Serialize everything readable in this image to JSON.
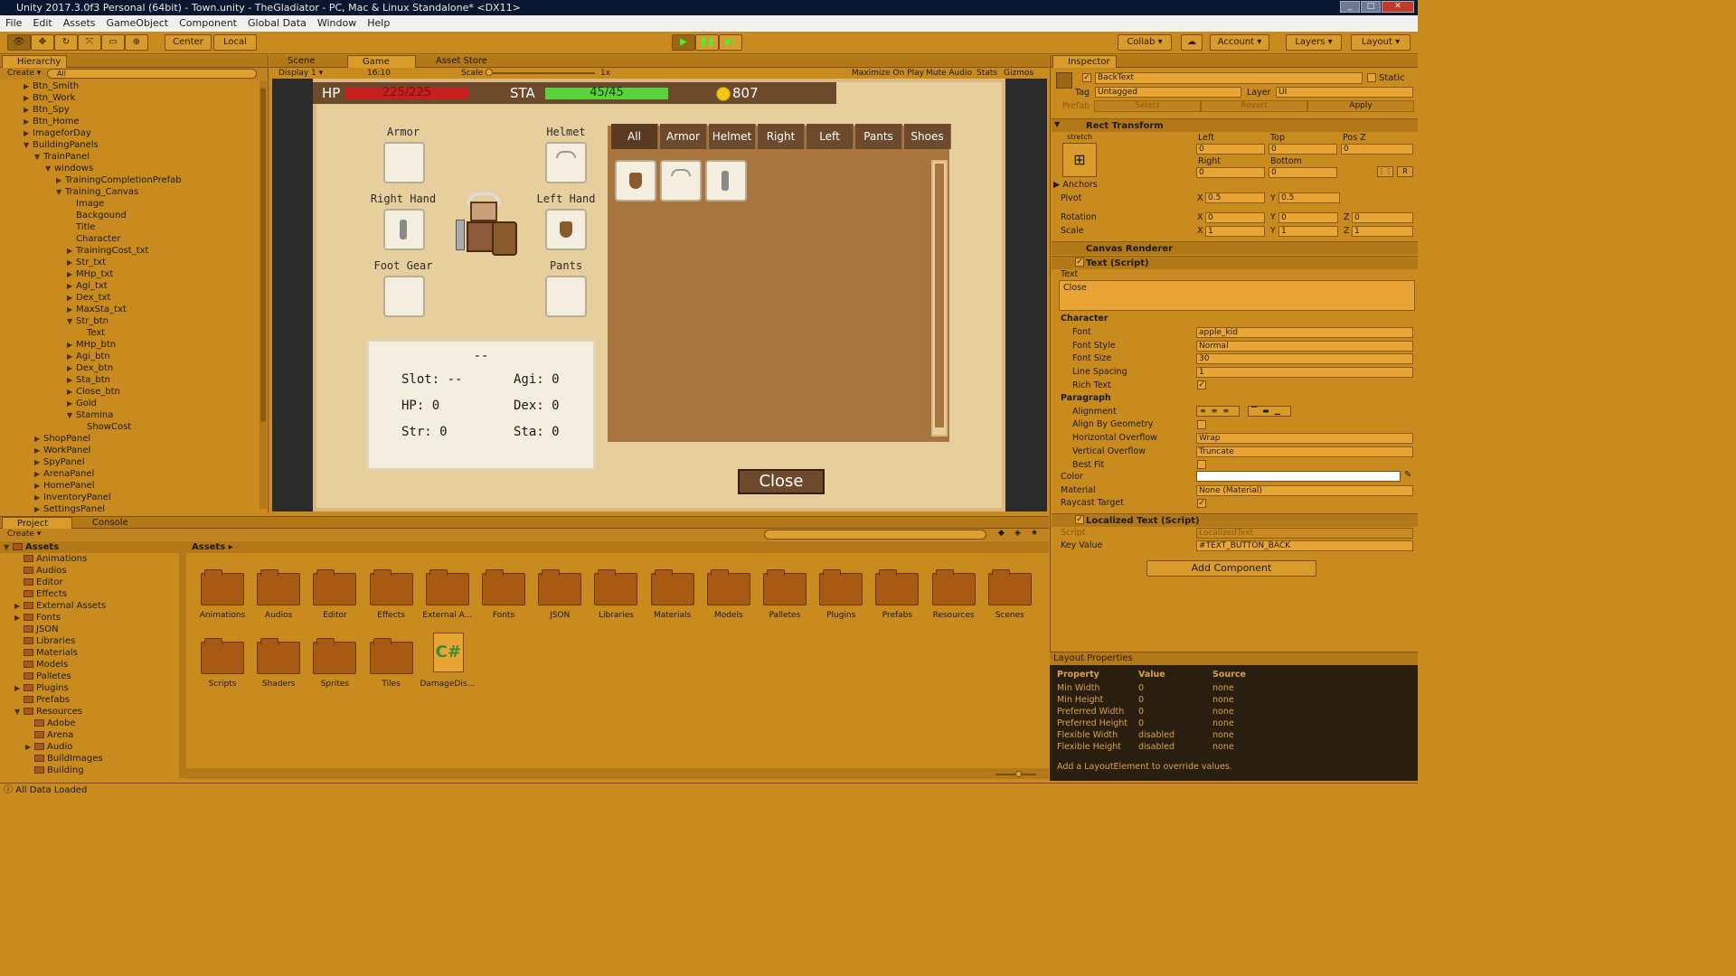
{
  "window": {
    "title": "Unity 2017.3.0f3 Personal (64bit) - Town.unity - TheGladiator - PC, Mac & Linux Standalone* <DX11>"
  },
  "menu": [
    "File",
    "Edit",
    "Assets",
    "GameObject",
    "Component",
    "Global Data",
    "Window",
    "Help"
  ],
  "toolbar": {
    "center": "Center",
    "local": "Local",
    "collab": "Collab",
    "account": "Account",
    "layers": "Layers",
    "layout": "Layout"
  },
  "hierarchy": {
    "tab": "Hierarchy",
    "create": "Create",
    "search_placeholder": "All",
    "items": [
      {
        "label": "Btn_Smith",
        "indent": 1,
        "arrow": "▶"
      },
      {
        "label": "Btn_Work",
        "indent": 1,
        "arrow": "▶"
      },
      {
        "label": "Btn_Spy",
        "indent": 1,
        "arrow": "▶"
      },
      {
        "label": "Btn_Home",
        "indent": 1,
        "arrow": "▶"
      },
      {
        "label": "ImageforDay",
        "indent": 1,
        "arrow": "▶"
      },
      {
        "label": "BuildingPanels",
        "indent": 1,
        "arrow": "▼"
      },
      {
        "label": "TrainPanel",
        "indent": 2,
        "arrow": "▼"
      },
      {
        "label": "windows",
        "indent": 3,
        "arrow": "▼"
      },
      {
        "label": "TrainingCompletionPrefab",
        "indent": 4,
        "arrow": "▶"
      },
      {
        "label": "Training_Canvas",
        "indent": 4,
        "arrow": "▼"
      },
      {
        "label": "Image",
        "indent": 5,
        "arrow": ""
      },
      {
        "label": "Backgound",
        "indent": 5,
        "arrow": ""
      },
      {
        "label": "Title",
        "indent": 5,
        "arrow": ""
      },
      {
        "label": "Character",
        "indent": 5,
        "arrow": ""
      },
      {
        "label": "TrainingCost_txt",
        "indent": 5,
        "arrow": "▶"
      },
      {
        "label": "Str_txt",
        "indent": 5,
        "arrow": "▶"
      },
      {
        "label": "MHp_txt",
        "indent": 5,
        "arrow": "▶"
      },
      {
        "label": "Agi_txt",
        "indent": 5,
        "arrow": "▶"
      },
      {
        "label": "Dex_txt",
        "indent": 5,
        "arrow": "▶"
      },
      {
        "label": "MaxSta_txt",
        "indent": 5,
        "arrow": "▶"
      },
      {
        "label": "Str_btn",
        "indent": 5,
        "arrow": "▼"
      },
      {
        "label": "Text",
        "indent": 6,
        "arrow": ""
      },
      {
        "label": "MHp_btn",
        "indent": 5,
        "arrow": "▶"
      },
      {
        "label": "Agi_btn",
        "indent": 5,
        "arrow": "▶"
      },
      {
        "label": "Dex_btn",
        "indent": 5,
        "arrow": "▶"
      },
      {
        "label": "Sta_btn",
        "indent": 5,
        "arrow": "▶"
      },
      {
        "label": "Close_btn",
        "indent": 5,
        "arrow": "▶"
      },
      {
        "label": "Gold",
        "indent": 5,
        "arrow": "▶"
      },
      {
        "label": "Stamina",
        "indent": 5,
        "arrow": "▼"
      },
      {
        "label": "ShowCost",
        "indent": 6,
        "arrow": ""
      },
      {
        "label": "ShopPanel",
        "indent": 2,
        "arrow": "▶"
      },
      {
        "label": "WorkPanel",
        "indent": 2,
        "arrow": "▶"
      },
      {
        "label": "SpyPanel",
        "indent": 2,
        "arrow": "▶"
      },
      {
        "label": "ArenaPanel",
        "indent": 2,
        "arrow": "▶"
      },
      {
        "label": "HomePanel",
        "indent": 2,
        "arrow": "▶"
      },
      {
        "label": "InventoryPanel",
        "indent": 2,
        "arrow": "▶"
      },
      {
        "label": "SettingsPanel",
        "indent": 2,
        "arrow": "▶"
      }
    ]
  },
  "view_tabs": {
    "scene": "Scene",
    "game": "Game",
    "store": "Asset Store"
  },
  "game_bar": {
    "display": "Display 1",
    "aspect": "16:10",
    "scale_label": "Scale",
    "scale_value": "1x",
    "maximize": "Maximize On Play",
    "mute": "Mute Audio",
    "stats": "Stats",
    "gizmos": "Gizmos"
  },
  "game": {
    "hp_label": "HP",
    "hp_value": "225/225",
    "hp_fraction": 1.0,
    "sta_label": "STA",
    "sta_value": "45/45",
    "sta_fraction": 1.0,
    "gold": "807",
    "slot_labels": {
      "armor": "Armor",
      "helmet": "Helmet",
      "right_hand": "Right Hand",
      "left_hand": "Left Hand",
      "foot_gear": "Foot Gear",
      "pants": "Pants"
    },
    "tabs": [
      "All",
      "Armor",
      "Helmet",
      "Right",
      "Left",
      "Pants",
      "Shoes"
    ],
    "info_title": "--",
    "stats": {
      "slot": "Slot: --",
      "hp": "HP: 0",
      "str": "Str: 0",
      "agi": "Agi: 0",
      "dex": "Dex: 0",
      "sta": "Sta: 0"
    },
    "close": "Close"
  },
  "inspector": {
    "tab": "Inspector",
    "object_name": "BackText",
    "static": "Static",
    "tag_label": "Tag",
    "tag_value": "Untagged",
    "layer_label": "Layer",
    "layer_value": "UI",
    "prefab": "Prefab",
    "select": "Select",
    "revert": "Revert",
    "apply": "Apply",
    "rect": {
      "title": "Rect Transform",
      "stretch": "stretch",
      "left": "Left",
      "top": "Top",
      "posz": "Pos Z",
      "left_v": "0",
      "top_v": "0",
      "posz_v": "0",
      "right": "Right",
      "bottom": "Bottom",
      "right_v": "0",
      "bottom_v": "0",
      "anchors": "Anchors",
      "pivot": "Pivot",
      "pivot_x": "0.5",
      "pivot_y": "0.5",
      "rotation": "Rotation",
      "rot_x": "0",
      "rot_y": "0",
      "rot_z": "0",
      "scale": "Scale",
      "sc_x": "1",
      "sc_y": "1",
      "sc_z": "1"
    },
    "canvas_renderer": "Canvas Renderer",
    "text": {
      "title": "Text (Script)",
      "text_label": "Text",
      "text_value": "Close",
      "character": "Character",
      "font": "Font",
      "font_v": "apple_kid",
      "font_style": "Font Style",
      "font_style_v": "Normal",
      "font_size": "Font Size",
      "font_size_v": "30",
      "line_spacing": "Line Spacing",
      "line_spacing_v": "1",
      "rich_text": "Rich Text",
      "paragraph": "Paragraph",
      "alignment": "Alignment",
      "align_geo": "Align By Geometry",
      "h_overflow": "Horizontal Overflow",
      "h_overflow_v": "Wrap",
      "v_overflow": "Vertical Overflow",
      "v_overflow_v": "Truncate",
      "best_fit": "Best Fit",
      "color": "Color",
      "color_v": "#ffffff",
      "material": "Material",
      "material_v": "None (Material)",
      "raycast": "Raycast Target"
    },
    "localized": {
      "title": "Localized Text (Script)",
      "script": "Script",
      "script_v": "LocalizedText",
      "key": "Key Value",
      "key_v": "#TEXT_BUTTON_BACK"
    },
    "add_component": "Add Component",
    "layout_props": {
      "title": "Layout Properties",
      "headers": [
        "Property",
        "Value",
        "Source"
      ],
      "rows": [
        [
          "Min Width",
          "0",
          "none"
        ],
        [
          "Min Height",
          "0",
          "none"
        ],
        [
          "Preferred Width",
          "0",
          "none"
        ],
        [
          "Preferred Height",
          "0",
          "none"
        ],
        [
          "Flexible Width",
          "disabled",
          "none"
        ],
        [
          "Flexible Height",
          "disabled",
          "none"
        ]
      ],
      "hint": "Add a LayoutElement to override values."
    }
  },
  "project": {
    "tab": "Project",
    "console": "Console",
    "create": "Create",
    "breadcrumb": "Assets",
    "tree": [
      {
        "label": "Assets",
        "indent": 0,
        "arrow": "▼",
        "bold": true
      },
      {
        "label": "Animations",
        "indent": 1,
        "arrow": ""
      },
      {
        "label": "Audios",
        "indent": 1,
        "arrow": ""
      },
      {
        "label": "Editor",
        "indent": 1,
        "arrow": ""
      },
      {
        "label": "Effects",
        "indent": 1,
        "arrow": ""
      },
      {
        "label": "External Assets",
        "indent": 1,
        "arrow": "▶"
      },
      {
        "label": "Fonts",
        "indent": 1,
        "arrow": "▶"
      },
      {
        "label": "JSON",
        "indent": 1,
        "arrow": ""
      },
      {
        "label": "Libraries",
        "indent": 1,
        "arrow": ""
      },
      {
        "label": "Materials",
        "indent": 1,
        "arrow": ""
      },
      {
        "label": "Models",
        "indent": 1,
        "arrow": ""
      },
      {
        "label": "Palletes",
        "indent": 1,
        "arrow": ""
      },
      {
        "label": "Plugins",
        "indent": 1,
        "arrow": "▶"
      },
      {
        "label": "Prefabs",
        "indent": 1,
        "arrow": ""
      },
      {
        "label": "Resources",
        "indent": 1,
        "arrow": "▼"
      },
      {
        "label": "Adobe",
        "indent": 2,
        "arrow": ""
      },
      {
        "label": "Arena",
        "indent": 2,
        "arrow": ""
      },
      {
        "label": "Audio",
        "indent": 2,
        "arrow": "▶"
      },
      {
        "label": "BuildImages",
        "indent": 2,
        "arrow": ""
      },
      {
        "label": "Building",
        "indent": 2,
        "arrow": ""
      }
    ],
    "folders": [
      "Animations",
      "Audios",
      "Editor",
      "Effects",
      "External A...",
      "Fonts",
      "JSON",
      "Libraries",
      "Materials",
      "Models",
      "Palletes",
      "Plugins",
      "Prefabs",
      "Resources",
      "Scenes",
      "Scripts",
      "Shaders",
      "Sprites",
      "Tiles"
    ],
    "script_file": "DamageDis...",
    "status": "All Data Loaded"
  },
  "colors": {
    "editor": "#c98a1e",
    "hp": "#c81e1e",
    "sta": "#5ad23c",
    "parchment": "#e7cf9d"
  }
}
